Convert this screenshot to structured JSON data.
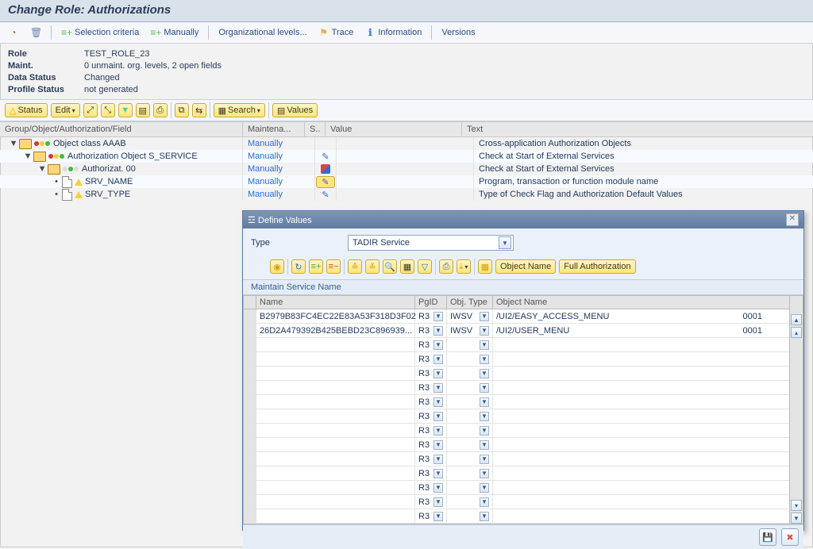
{
  "title": "Change Role: Authorizations",
  "toolbar": {
    "selection_criteria": "Selection criteria",
    "manually": "Manually",
    "org_levels": "Organizational levels...",
    "trace": "Trace",
    "information": "Information",
    "versions": "Versions"
  },
  "info": {
    "role_lbl": "Role",
    "role_val": "TEST_ROLE_23",
    "maint_lbl": "Maint.",
    "maint_val": "0 unmaint. org. levels, 2 open fields",
    "ds_lbl": "Data Status",
    "ds_val": "Changed",
    "ps_lbl": "Profile Status",
    "ps_val": "not generated"
  },
  "ytb": {
    "status": "Status",
    "edit": "Edit",
    "search": "Search",
    "values": "Values"
  },
  "grid_hdr": {
    "tree": "Group/Object/Authorization/Field",
    "maint": "Maintena...",
    "flag": "S..",
    "value": "Value",
    "text": "Text"
  },
  "tree": [
    {
      "indent": 0,
      "twisty": "▼",
      "folder": true,
      "lights": "ryg",
      "label": "Object class AAAB",
      "maint": "Manually",
      "flag": "",
      "text": "Cross-application Authorization Objects"
    },
    {
      "indent": 1,
      "twisty": "▼",
      "folder": true,
      "lights": "ryg",
      "label": "Authorization Object S_SERVICE",
      "maint": "Manually",
      "flag": "pen",
      "text": "Check at Start of External Services"
    },
    {
      "indent": 2,
      "twisty": "▼",
      "folder": true,
      "lights": "ogo",
      "label": "Authorizat. 00",
      "maint": "Manually",
      "flag": "diagpen",
      "text": "Check at Start of External Services"
    },
    {
      "indent": 3,
      "twisty": "•",
      "doc": true,
      "tri": true,
      "label": "SRV_NAME",
      "maint": "Manually",
      "flag": "penhl",
      "text": "Program, transaction or function module name"
    },
    {
      "indent": 3,
      "twisty": "•",
      "doc": true,
      "tri": true,
      "label": "SRV_TYPE",
      "maint": "Manually",
      "flag": "pen",
      "text": "Type of Check Flag and Authorization Default Values"
    }
  ],
  "dialog": {
    "title": "Define Values",
    "type_lbl": "Type",
    "type_val": "TADIR Service",
    "object_name_btn": "Object Name",
    "full_auth_btn": "Full Authorization",
    "subheader": "Maintain Service Name",
    "cols": {
      "sel": "",
      "name": "Name",
      "pgid": "PgID",
      "objtype": "Obj. Type",
      "objname": "Object Name"
    },
    "rows": [
      {
        "name": "B2979B83FC4EC22E83A53F318D3F02",
        "pgid": "R3",
        "ot": "IWSV",
        "on": "/UI2/EASY_ACCESS_MENU",
        "seq": "0001"
      },
      {
        "name": "26D2A479392B425BEBD23C896939...",
        "pgid": "R3",
        "ot": "IWSV",
        "on": "/UI2/USER_MENU",
        "seq": "0001"
      }
    ],
    "empty_rows": 13,
    "default_pgid": "R3"
  }
}
